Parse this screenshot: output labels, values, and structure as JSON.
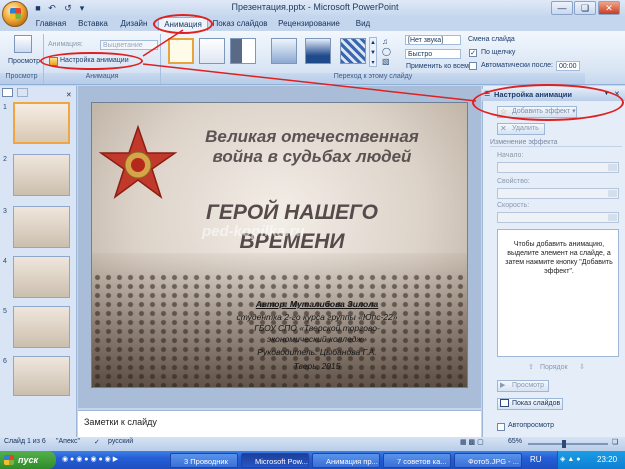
{
  "window": {
    "title": "Презентация.pptx - Microsoft PowerPoint"
  },
  "tabs": [
    {
      "label": "Главная"
    },
    {
      "label": "Вставка"
    },
    {
      "label": "Дизайн"
    },
    {
      "label": "Анимация",
      "active": true
    },
    {
      "label": "Показ слайдов"
    },
    {
      "label": "Рецензирование"
    },
    {
      "label": "Вид"
    }
  ],
  "ribbon": {
    "preview_label": "Просмотр",
    "animation_label": "Анимация:",
    "animation_value": "Выцветание",
    "custom_animation_label": "Настройка анимации",
    "group_preview": "Просмотр",
    "group_animation": "Анимация",
    "group_transition": "Переход к этому слайду",
    "sound_value": "[Нет звука]",
    "speed_value": "Быстро",
    "apply_all_label": "Применить ко всем",
    "advance_title": "Смена слайда",
    "on_click_label": "По щелчку",
    "auto_after_label": "Автоматически после:",
    "auto_after_value": "00:00"
  },
  "slide": {
    "title_line1": "Великая отечественная",
    "title_line2": "война в судьбах людей",
    "hero_line1": "ГЕРОЙ НАШЕГО",
    "hero_line2": "ВРЕМЕНИ",
    "watermark": "ped-kopilka.ru",
    "author": "Автор: Муталибова Зилола",
    "student": "студентка 2-го курса группы «Юпс-22»",
    "school1": "ГБОУ СПО «Тверской торгово-",
    "school2": "экономический колледж»",
    "supervisor": "Руководитель: Цыбанова Г.А.",
    "city": "Тверь, 2015"
  },
  "slides_pane": {
    "numbers": [
      "1",
      "2",
      "3",
      "4",
      "5",
      "6"
    ]
  },
  "notes": {
    "placeholder": "Заметки к слайду"
  },
  "taskpane": {
    "title": "Настройка анимации",
    "add_effect": "Добавить эффект",
    "remove": "Удалить",
    "change_effect": "Изменение эффекта",
    "start_label": "Начало:",
    "property_label": "Свойство:",
    "speed_label": "Скорость:",
    "hint": "Чтобы добавить анимацию, выделите элемент на слайде, а затем нажмите кнопку \"Добавить эффект\".",
    "order_label": "Порядок",
    "preview_label": "Просмотр",
    "slideshow_label": "Показ слайдов",
    "autopreview_label": "Автопросмотр"
  },
  "statusbar": {
    "slide_info": "Слайд 1 из 6",
    "theme": "\"Апекс\"",
    "language": "русский",
    "zoom": "65%"
  },
  "taskbar": {
    "start": "пуск",
    "items": [
      {
        "label": "3 Проводник"
      },
      {
        "label": "Microsoft Pow..."
      },
      {
        "label": "Анимация пр..."
      },
      {
        "label": "7 советов ка..."
      },
      {
        "label": "Фото5.JPG - ..."
      }
    ],
    "language": "RU",
    "time": "23:20"
  },
  "colors": {
    "accent": "#e02020",
    "taskbar": "#245ed6"
  }
}
